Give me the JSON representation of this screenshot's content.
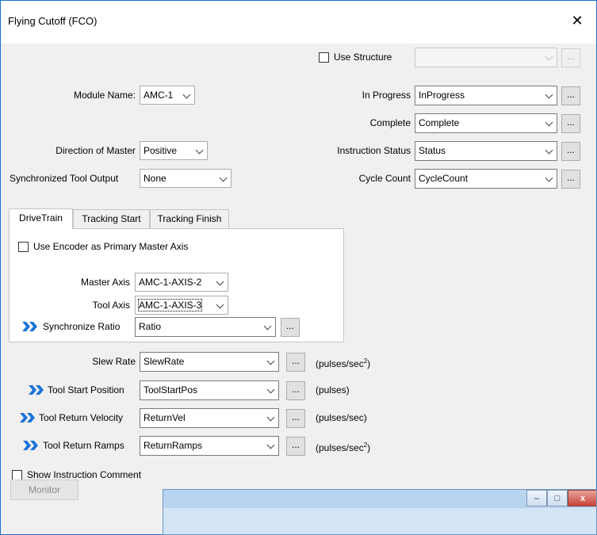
{
  "window": {
    "title": "Flying Cutoff (FCO)",
    "close_glyph": "✕"
  },
  "use_structure": {
    "label": "Use Structure",
    "checked": false,
    "value": "",
    "browse": "..."
  },
  "left_fields": {
    "module_name": {
      "label": "Module Name:",
      "value": "AMC-1"
    },
    "direction_of_master": {
      "label": "Direction of Master",
      "value": "Positive"
    },
    "sync_tool_output": {
      "label": "Synchronized Tool Output",
      "value": "None"
    }
  },
  "right_fields": [
    {
      "label": "In Progress",
      "value": "InProgress",
      "browse": "..."
    },
    {
      "label": "Complete",
      "value": "Complete",
      "browse": "..."
    },
    {
      "label": "Instruction Status",
      "value": "Status",
      "browse": "..."
    },
    {
      "label": "Cycle Count",
      "value": "CycleCount",
      "browse": "..."
    }
  ],
  "tabs": {
    "items": [
      "DriveTrain",
      "Tracking Start",
      "Tracking Finish"
    ],
    "active": "DriveTrain",
    "drivetrain": {
      "use_encoder": {
        "label": "Use Encoder as Primary Master Axis",
        "checked": false
      },
      "master_axis": {
        "label": "Master Axis",
        "value": "AMC-1-AXIS-2"
      },
      "tool_axis": {
        "label": "Tool Axis",
        "value": "AMC-1-AXIS-3"
      },
      "sync_ratio": {
        "label": "Synchronize Ratio",
        "value": "Ratio",
        "browse": "...",
        "icon": "double-chevron-icon"
      }
    }
  },
  "params": [
    {
      "label": "Slew Rate",
      "value": "SlewRate",
      "browse": "...",
      "unit": "(pulses/sec",
      "unit_sup": "2",
      "unit_end": ")",
      "expand_icon": false
    },
    {
      "label": "Tool Start Position",
      "value": "ToolStartPos",
      "browse": "...",
      "unit": "(pulses)",
      "unit_sup": "",
      "unit_end": "",
      "expand_icon": true
    },
    {
      "label": "Tool Return Velocity",
      "value": "ReturnVel",
      "browse": "...",
      "unit": "(pulses/sec)",
      "unit_sup": "",
      "unit_end": "",
      "expand_icon": true
    },
    {
      "label": "Tool Return Ramps",
      "value": "ReturnRamps",
      "browse": "...",
      "unit": "(pulses/sec",
      "unit_sup": "2",
      "unit_end": ")",
      "expand_icon": true
    }
  ],
  "show_comment": {
    "label": "Show Instruction Comment",
    "checked": false
  },
  "monitor_button": {
    "label": "Monitor",
    "enabled": false
  },
  "background_window": {
    "min_glyph": "–",
    "max_glyph": "□",
    "close_glyph": "x"
  },
  "colors": {
    "accent_chevron": "#1a73d9",
    "dialog_border": "#1c6fd2",
    "dialog_bg": "#f0f0f0"
  }
}
